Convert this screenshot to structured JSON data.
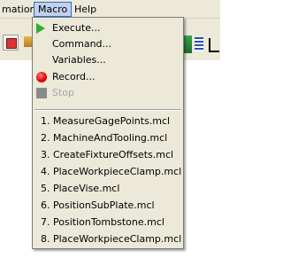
{
  "menubar": {
    "left_partial": "mation",
    "macro": "Macro",
    "help": "Help"
  },
  "menu": {
    "execute": "Execute...",
    "command": "Command...",
    "variables": "Variables...",
    "record": "Record...",
    "stop": "Stop",
    "recent": [
      "1. MeasureGagePoints.mcl",
      "2. MachineAndTooling.mcl",
      "3. CreateFixtureOffsets.mcl",
      "4. PlaceWorkpieceClamp.mcl",
      "5. PlaceVise.mcl",
      "6. PositionSubPlate.mcl",
      "7. PositionTombstone.mcl",
      "8. PlaceWorkpieceClamp.mcl"
    ]
  },
  "icons": {
    "execute": "play-icon",
    "record": "record-icon",
    "stop": "stop-icon"
  }
}
